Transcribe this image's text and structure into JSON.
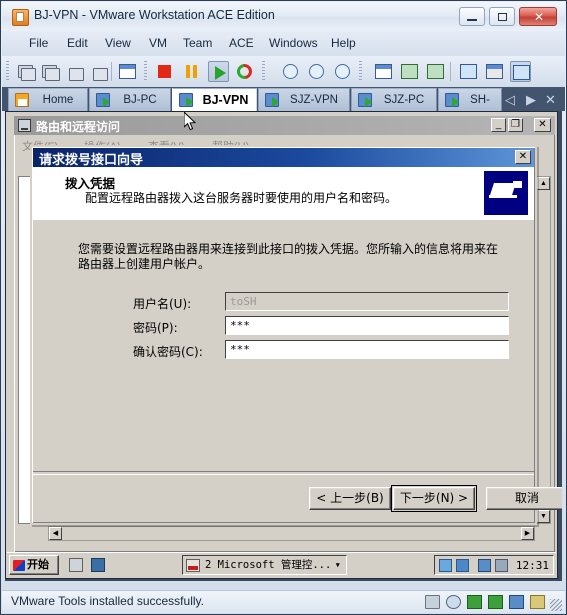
{
  "app": {
    "title": "BJ-VPN - VMware Workstation ACE Edition",
    "title_icon": "vmware-icon",
    "window_buttons": {
      "minimize": "—",
      "maximize": "□",
      "close": "✕"
    }
  },
  "menubar": {
    "items": [
      {
        "label": "File"
      },
      {
        "label": "Edit"
      },
      {
        "label": "View"
      },
      {
        "label": "VM"
      },
      {
        "label": "Team"
      },
      {
        "label": "ACE"
      },
      {
        "label": "Windows"
      },
      {
        "label": "Help"
      }
    ]
  },
  "toolbar": {
    "icons": [
      {
        "name": "power-on-team-icon"
      },
      {
        "name": "power-off-team-icon"
      },
      {
        "name": "suspend-team-icon"
      },
      {
        "name": "reset-team-icon"
      },
      {
        "name": "snapshot-team-icon"
      },
      {
        "name": "power-off-icon"
      },
      {
        "name": "suspend-icon"
      },
      {
        "name": "power-on-icon"
      },
      {
        "name": "reset-icon"
      },
      {
        "name": "take-snapshot-icon"
      },
      {
        "name": "revert-snapshot-icon"
      },
      {
        "name": "snapshot-manager-icon"
      },
      {
        "name": "show-sidebar-icon"
      },
      {
        "name": "quick-switch-icon"
      },
      {
        "name": "full-screen-icon"
      },
      {
        "name": "settings-icon"
      },
      {
        "name": "summary-icon"
      },
      {
        "name": "console-view-icon"
      }
    ]
  },
  "tabs": {
    "items": [
      {
        "label": "Home",
        "icon": "home-icon",
        "active": false
      },
      {
        "label": "BJ-PC",
        "icon": "vm-icon",
        "active": false
      },
      {
        "label": "BJ-VPN",
        "icon": "vm-icon",
        "active": true
      },
      {
        "label": "SJZ-VPN",
        "icon": "vm-icon",
        "active": false
      },
      {
        "label": "SJZ-PC",
        "icon": "vm-icon",
        "active": false
      },
      {
        "label": "SH-",
        "icon": "vm-icon",
        "active": false
      }
    ],
    "nav": {
      "prev": "◁",
      "next": "▶",
      "close": "✕"
    }
  },
  "guest": {
    "mmc": {
      "title": "路由和远程访问",
      "title_icon": "console-icon",
      "buttons": {
        "minimize": "_",
        "restore": "❐",
        "close": "✕"
      },
      "menu": [
        {
          "label": "文件(F)"
        },
        {
          "label": "操作(A)"
        },
        {
          "label": "查看(V)"
        },
        {
          "label": "帮助(H)"
        }
      ]
    },
    "dialog": {
      "title": "请求拨号接口向导",
      "close_label": "✕",
      "header_title": "拨入凭据",
      "header_subtitle": "配置远程路由器拨入这台服务器时要使用的用户名和密码。",
      "header_icon": "network-connection-icon",
      "body_text": "您需要设置远程路由器用来连接到此接口的拨入凭据。您所输入的信息将用来在路由器上创建用户帐户。",
      "fields": [
        {
          "label": "用户名(U):",
          "value": "toSH",
          "disabled": true,
          "name": "username-field"
        },
        {
          "label": "密码(P):",
          "value": "***",
          "disabled": false,
          "name": "password-field"
        },
        {
          "label": "确认密码(C):",
          "value": "***",
          "disabled": false,
          "name": "confirm-password-field"
        }
      ],
      "buttons": [
        {
          "label": "< 上一步(B)",
          "name": "back-button",
          "default": false
        },
        {
          "label": "下一步(N) >",
          "name": "next-button",
          "default": true
        },
        {
          "label": "取消",
          "name": "cancel-button",
          "default": false
        }
      ]
    },
    "taskbar": {
      "start_label": "开始",
      "quick_launch": [
        {
          "name": "show-desktop-icon"
        },
        {
          "name": "media-player-icon"
        }
      ],
      "task": "2 Microsoft 管理控...",
      "task_arrow": "▾",
      "tray": [
        {
          "name": "network-tray-icon"
        },
        {
          "name": "vmware-tray-icon"
        },
        {
          "name": "connection-tray-icon"
        },
        {
          "name": "volume-muted-tray-icon"
        }
      ],
      "time": "12:31"
    }
  },
  "statusbar": {
    "text": "VMware Tools installed successfully.",
    "icons": [
      {
        "name": "floppy-status-icon"
      },
      {
        "name": "cdrom-status-icon"
      },
      {
        "name": "network-status-icon"
      },
      {
        "name": "network2-status-icon"
      },
      {
        "name": "sound-status-icon"
      },
      {
        "name": "usb-status-icon"
      }
    ]
  },
  "colors": {
    "accent": "#0a246a",
    "dialog_face": "#d4d0c8",
    "tabbar": "#42546e",
    "header_icon": "#000080"
  }
}
